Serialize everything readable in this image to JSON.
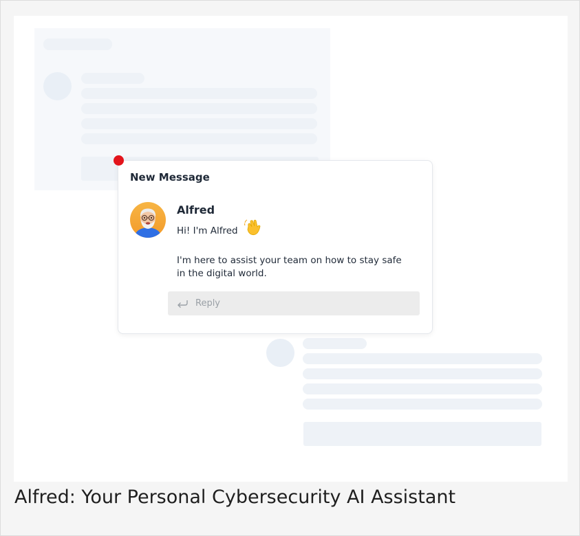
{
  "notification": {
    "title": "New Message",
    "sender": "Alfred",
    "greeting": "Hi! I'm Alfred",
    "message": "I'm here to assist your team on how to stay safe in the digital world.",
    "reply_placeholder": "Reply",
    "status_dot_color": "#e3141b"
  },
  "caption": "Alfred: Your Personal Cybersecurity AI Assistant",
  "icons": {
    "avatar": "alfred-avatar",
    "wave": "waving-hand-icon",
    "reply": "reply-arrow-icon"
  }
}
